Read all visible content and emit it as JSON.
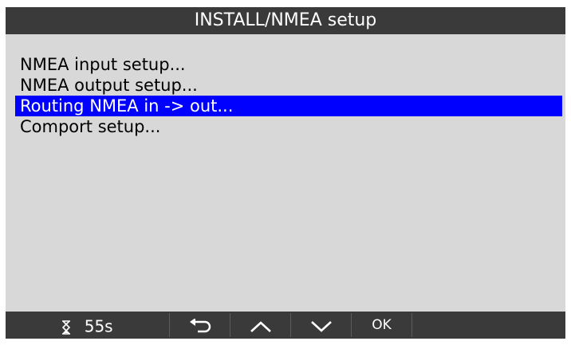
{
  "header": {
    "title": "INSTALL/NMEA setup"
  },
  "menu": {
    "items": [
      {
        "label": "NMEA input setup..."
      },
      {
        "label": "NMEA output setup..."
      },
      {
        "label": "Routing NMEA in -> out..."
      },
      {
        "label": "Comport setup..."
      }
    ],
    "selected_index": 2
  },
  "bottom_bar": {
    "timer_icon": "hourglass-icon",
    "timer_value": "55s",
    "back_icon": "return-arrow-icon",
    "up_icon": "chevron-up-icon",
    "down_icon": "chevron-down-icon",
    "ok_label": "OK"
  },
  "colors": {
    "background": "#d8d8d8",
    "bar": "#3a3a3a",
    "selection": "#0000ff"
  }
}
